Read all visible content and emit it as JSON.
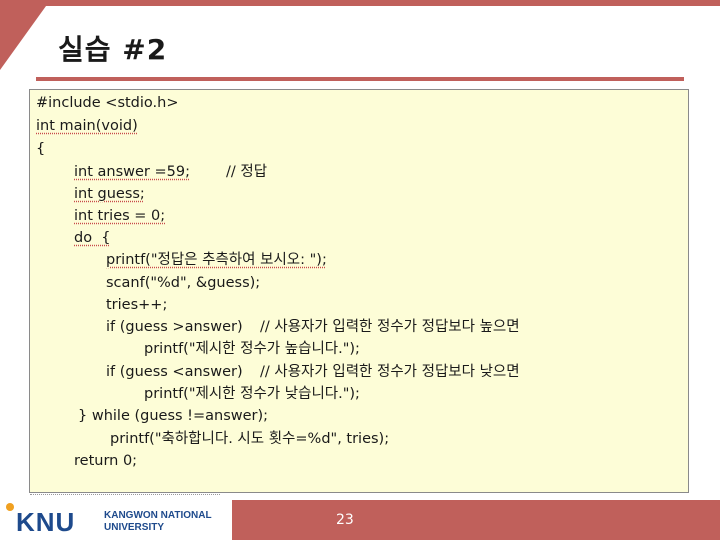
{
  "slide": {
    "title": "실습 #2",
    "page_number": "23"
  },
  "code_lines": [
    "#include <stdio.h>",
    "int main(void)",
    "{",
    "int answer =59;",
    "// 정답",
    "int guess;",
    "int tries = 0;",
    "do  {",
    "printf(\"정답은 추측하여 보시오: \");",
    "scanf(\"%d\", &guess);",
    "tries++;",
    "if (guess >answer)",
    "// 사용자가 입력한 정수가 정답보다 높으면",
    "printf(\"제시한 정수가 높습니다.\");",
    "if (guess <answer)",
    "// 사용자가 입력한 정수가 정답보다 낮으면",
    "printf(\"제시한 정수가 낮습니다.\");",
    "} while (guess !=answer);",
    "printf(\"축하합니다. 시도 횟수=%d\", tries);",
    "return 0;"
  ],
  "footer": {
    "logo_text": "KNU",
    "university_line1": "KANGWON NATIONAL",
    "university_line2": "UNIVERSITY"
  },
  "colors": {
    "accent": "#c0605b",
    "code_background": "#fdfdd7",
    "logo_blue": "#1e4a8c"
  }
}
